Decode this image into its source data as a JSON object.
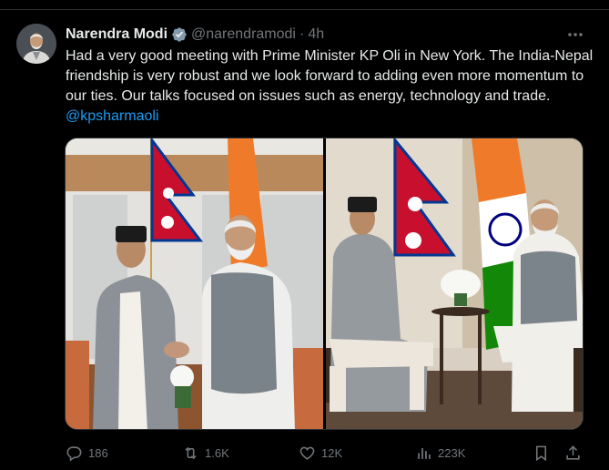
{
  "author": {
    "name": "Narendra Modi",
    "handle": "@narendramodi",
    "separator": "·",
    "time": "4h"
  },
  "tweet": {
    "text": "Had a very good meeting with Prime Minister KP Oli in New York. The India-Nepal friendship is very robust and we look forward to adding even more momentum to our ties. Our talks focused on issues such as energy, technology and trade. ",
    "mention": "@kpsharmaoli"
  },
  "stats": {
    "replies": "186",
    "reposts": "1.6K",
    "likes": "12K",
    "views": "223K"
  },
  "icons": {
    "verified": "verified-badge-icon",
    "more": "more-icon",
    "reply": "reply-icon",
    "repost": "repost-icon",
    "like": "like-icon",
    "views": "views-icon",
    "bookmark": "bookmark-icon",
    "share": "share-icon"
  },
  "colors": {
    "background": "#000000",
    "text": "#e7e9ea",
    "muted": "#71767b",
    "accent": "#1d9bf0"
  }
}
